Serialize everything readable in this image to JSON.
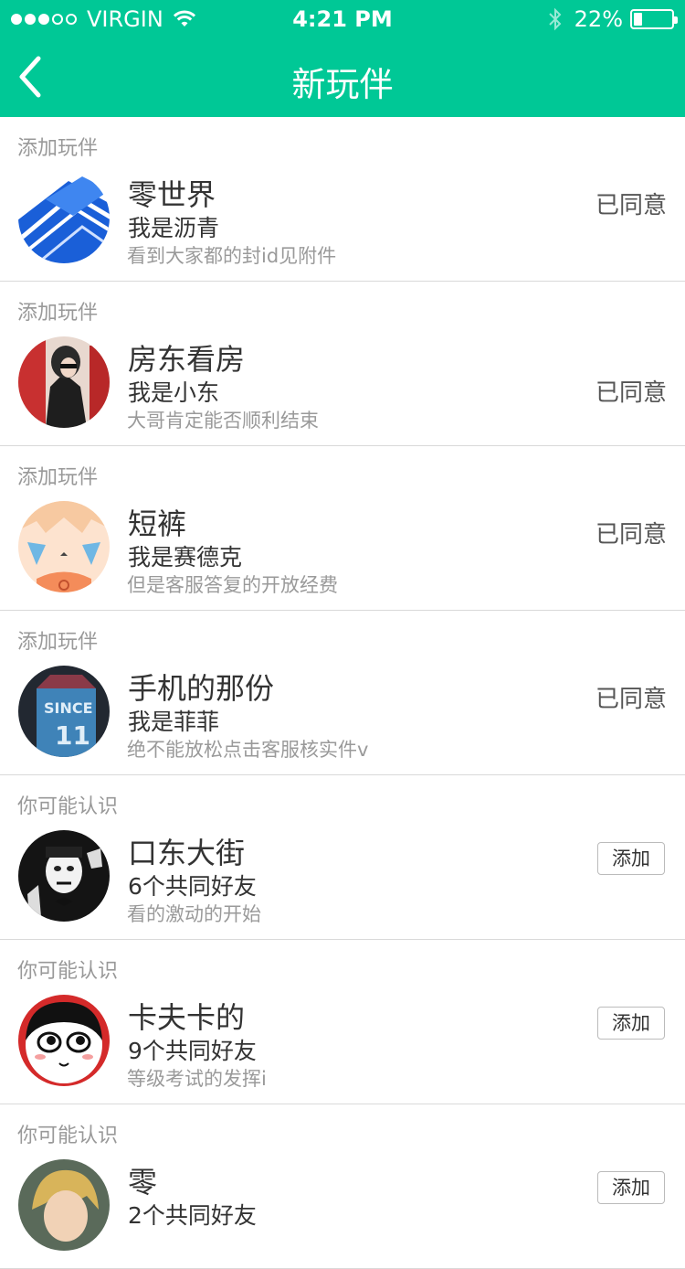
{
  "status_bar": {
    "carrier": "VIRGIN",
    "time": "4:21 PM",
    "battery_percent": "22%",
    "battery_level": 0.22,
    "signal_bars_filled": 3,
    "signal_bars_total": 5,
    "wifi_icon": "wifi-icon",
    "bluetooth_icon": "bluetooth-icon"
  },
  "nav": {
    "title": "新玩伴",
    "back_icon": "chevron-left-icon",
    "accent_color": "#00c896"
  },
  "items": [
    {
      "section": "添加玩伴",
      "name": "零世界",
      "line2": "我是沥青",
      "line3": "看到大家都的封id见附件",
      "action_type": "status",
      "action": "已同意"
    },
    {
      "section": "添加玩伴",
      "name": "房东看房",
      "line2": "我是小东",
      "line3": "大哥肯定能否顺利结束",
      "action_type": "status",
      "action": "已同意"
    },
    {
      "section": "添加玩伴",
      "name": "短裤",
      "line2": "我是赛德克",
      "line3": "但是客服答复的开放经费",
      "action_type": "status",
      "action": "已同意"
    },
    {
      "section": "添加玩伴",
      "name": "手机的那份",
      "line2": "我是菲菲",
      "line3": "绝不能放松点击客服核实件v",
      "action_type": "status",
      "action": "已同意"
    },
    {
      "section": "你可能认识",
      "name": "口东大街",
      "line2": "6个共同好友",
      "line3": "看的激动的开始",
      "action_type": "button",
      "action": "添加"
    },
    {
      "section": "你可能认识",
      "name": "卡夫卡的",
      "line2": "9个共同好友",
      "line3": "等级考试的发挥i",
      "action_type": "button",
      "action": "添加"
    },
    {
      "section": "你可能认识",
      "name": "零",
      "line2": "2个共同好友",
      "line3": "",
      "action_type": "button",
      "action": "添加"
    }
  ]
}
